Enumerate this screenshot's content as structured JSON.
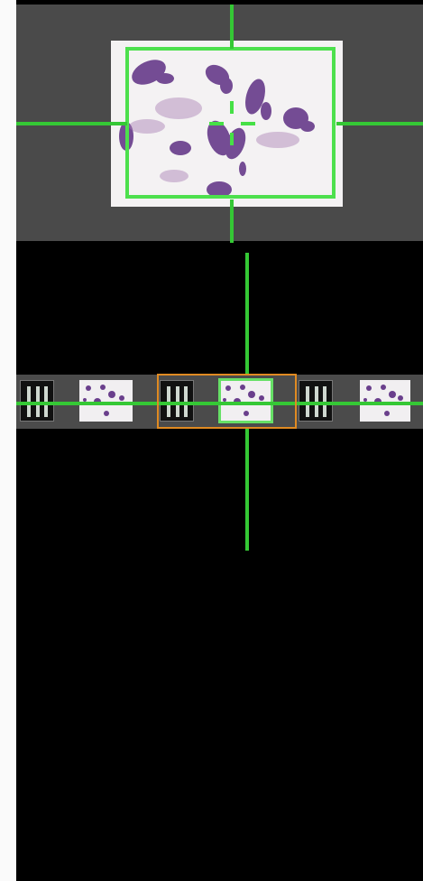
{
  "viewer": {
    "overview_image": "slide-overview-tissue",
    "thumbnails": [
      {
        "kind": "label",
        "image": "slide-label-image"
      },
      {
        "kind": "tissue",
        "image": "slide-tissue-thumbnail"
      },
      {
        "kind": "label",
        "image": "slide-label-image"
      },
      {
        "kind": "tissue",
        "image": "slide-tissue-thumbnail",
        "selected": true
      },
      {
        "kind": "label",
        "image": "slide-label-image"
      },
      {
        "kind": "tissue",
        "image": "slide-tissue-thumbnail"
      }
    ],
    "colors": {
      "overview_background": "#4a4a4a",
      "crosshair": "#35c835",
      "roi_outline": "#4de04d",
      "selection_outline": "#e08a22",
      "tissue_stain": "#6a3f8c"
    }
  }
}
